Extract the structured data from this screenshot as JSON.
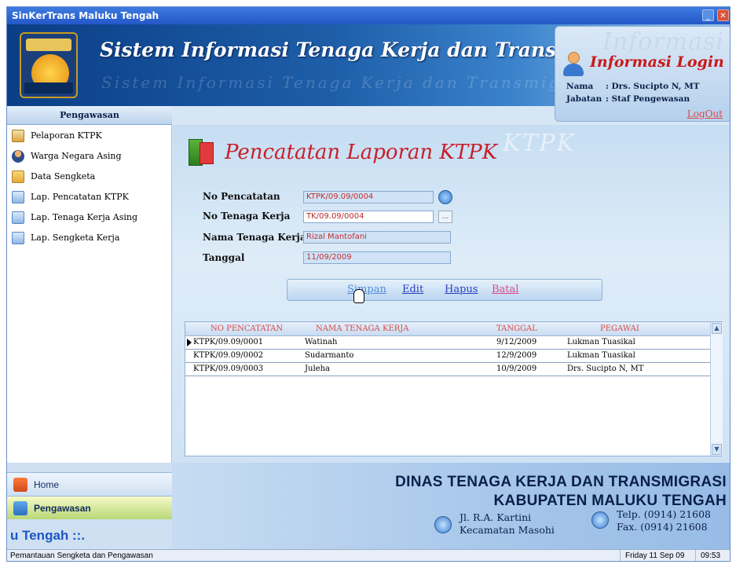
{
  "window": {
    "title": "SinKerTrans Maluku Tengah"
  },
  "banner": {
    "app_title": "Sistem Informasi Tenaga Kerja dan Transmigrasi"
  },
  "login": {
    "ghost": "Informasi",
    "title": "Informasi Login",
    "name_label": "Nama",
    "name_value": ": Drs. Sucipto N, MT",
    "role_label": "Jabatan",
    "role_value": ": Staf Pengewasan",
    "logout": "LogOut"
  },
  "sidebar": {
    "header": "Pengawasan",
    "items": [
      {
        "label": "Pelaporan KTPK",
        "icon": "report-icon"
      },
      {
        "label": "Warga Negara Asing",
        "icon": "person-icon"
      },
      {
        "label": "Data Sengketa",
        "icon": "folder-icon"
      },
      {
        "label": "Lap. Pencatatan KTPK",
        "icon": "document-icon"
      },
      {
        "label": "Lap. Tenaga Kerja Asing",
        "icon": "document-icon"
      },
      {
        "label": "Lap. Sengketa Kerja",
        "icon": "document-icon"
      }
    ]
  },
  "form": {
    "page_title": "Pencatatan Laporan KTPK",
    "page_ghost": "KTPK",
    "fields": [
      {
        "label": "No Pencatatan",
        "value": "KTPK/09.09/0004"
      },
      {
        "label": "No Tenaga Kerja",
        "value": "TK/09.09/0004"
      },
      {
        "label": "Nama Tenaga Kerja",
        "value": "Rizal Mantofani"
      },
      {
        "label": "Tanggal",
        "value": "11/09/2009"
      }
    ],
    "dots": "..."
  },
  "toolbar": {
    "save": "Simpan",
    "edit": "Edit",
    "delete": "Hapus",
    "cancel": "Batal"
  },
  "grid": {
    "columns": [
      "NO PENCATATAN",
      "NAMA TENAGA KERJA",
      "TANGGAL",
      "PEGAWAI"
    ],
    "rows": [
      {
        "no": "KTPK/09.09/0001",
        "nama": "Watinah",
        "tanggal": "9/12/2009",
        "pegawai": "Lukman Tuasikal"
      },
      {
        "no": "KTPK/09.09/0002",
        "nama": "Sudarmanto",
        "tanggal": "12/9/2009",
        "pegawai": "Lukman Tuasikal"
      },
      {
        "no": "KTPK/09.09/0003",
        "nama": "Juleha",
        "tanggal": "10/9/2009",
        "pegawai": "Drs. Sucipto N, MT"
      }
    ]
  },
  "nav": {
    "home": "Home",
    "pengawasan": "Pengawasan",
    "ticker": "u Tengah ::."
  },
  "dept": {
    "line1": "DINAS TENAGA KERJA DAN TRANSMIGRASI",
    "line2": "KABUPATEN MALUKU TENGAH",
    "address1": "Jl. R.A. Kartini",
    "address2": "Kecamatan Masohi",
    "phone": "Telp. (0914) 21608",
    "fax": "Fax.  (0914) 21608"
  },
  "status": {
    "left": "Pemantauan Sengketa dan Pengawasan",
    "date": "Friday 11 Sep 09",
    "time": "09:53"
  },
  "colors": {
    "title_red": "#c71f2b",
    "link_blue": "#2a3dbf",
    "banner_blue": "#0a3e86"
  }
}
